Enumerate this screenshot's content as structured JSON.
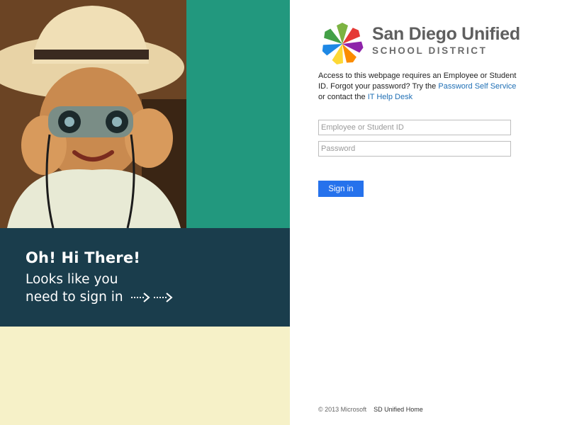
{
  "banner": {
    "title": "Oh! Hi There!",
    "subtitle_line1": "Looks like you",
    "subtitle_line2": "need to sign in"
  },
  "logo": {
    "name_line1": "San Diego Unified",
    "name_line2": "SCHOOL DISTRICT"
  },
  "intro": {
    "text_before": "Access to this webpage requires an Employee or Student ID. Forgot your password? Try the ",
    "link1": "Password Self Service",
    "text_middle": " or contact the ",
    "link2": "IT Help Desk"
  },
  "form": {
    "user_placeholder": "Employee or Student ID",
    "password_placeholder": "Password",
    "submit_label": "Sign in"
  },
  "footer": {
    "copyright": "© 2013 Microsoft",
    "home_link": "SD Unified Home"
  },
  "colors": {
    "teal": "#22987e",
    "navy": "#1a3d4c",
    "cream": "#f6f1c8",
    "button": "#2672ec",
    "link": "#1f6fb5"
  }
}
